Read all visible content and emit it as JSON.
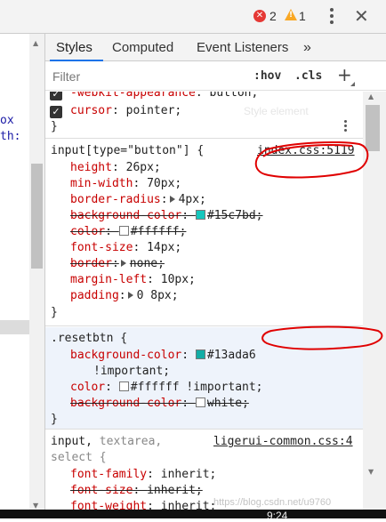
{
  "topbar": {
    "error_count": "2",
    "warning_count": "1",
    "error_icon_glyph": "✕",
    "warning_icon_glyph": "!",
    "close_glyph": "✕"
  },
  "left_pane": {
    "fragment_1": "ox",
    "fragment_2": "th:"
  },
  "tabs": [
    {
      "label": "Styles",
      "active": true
    },
    {
      "label": "Computed"
    },
    {
      "label": "Event Listeners"
    }
  ],
  "tabs_more": "»",
  "filter": {
    "placeholder": "Filter",
    "hov": ":hov",
    "cls": ".cls",
    "add": "+"
  },
  "rules": {
    "r0": {
      "line1_prop": "-webkit-appearance",
      "line1_val": "button;",
      "line2_prop": "cursor",
      "line2_val": "pointer;",
      "close": "}"
    },
    "r1": {
      "selector": "input[type=\"button\"] {",
      "source": "index.css:5119",
      "decls": [
        {
          "prop": "height",
          "val": "26px;"
        },
        {
          "prop": "min-width",
          "val": "70px;"
        },
        {
          "prop": "border-radius",
          "val": "4px;"
        },
        {
          "prop": "background-color",
          "val": "#15c7bd;",
          "swatch": "#15c7bd"
        },
        {
          "prop": "color",
          "val": "#ffffff;",
          "swatch": "#ffffff"
        },
        {
          "prop": "font-size",
          "val": "14px;"
        },
        {
          "prop": "border",
          "val": "none;"
        },
        {
          "prop": "margin-left",
          "val": "10px;"
        },
        {
          "prop": "padding",
          "val": "0 8px;"
        }
      ],
      "close": "}"
    },
    "r2": {
      "selector": ".resetbtn {",
      "decls": [
        {
          "prop": "background-color",
          "val": "#13ada6",
          "swatch": "#13ada6",
          "cont": "!important;"
        },
        {
          "prop": "color",
          "val": "#ffffff !important;",
          "swatch": "#ffffff"
        },
        {
          "prop": "background-color",
          "val": "white;",
          "swatch": "#ffffff"
        }
      ],
      "close": "}"
    },
    "r3": {
      "selector_1": "input,",
      "selector_2": "textarea,",
      "selector_3": "select {",
      "source": "ligerui-common.css:4",
      "decls": [
        {
          "prop": "font-family",
          "val": "inherit;"
        },
        {
          "prop": "font-size",
          "val": "inherit;"
        },
        {
          "prop": "font-weight",
          "val": "inherit;"
        }
      ]
    }
  },
  "bottom": {
    "clock": "9:24",
    "watermark": "https://blog.csdn.net/u9760",
    "faint_tip": "Style element"
  },
  "colors": {
    "accent": "#1a73e8",
    "prop": "#c80000",
    "annotation": "#e00000"
  },
  "icons": [
    "error-icon",
    "warning-icon",
    "kebab-icon",
    "close-icon",
    "checkbox-icon",
    "expand-triangle-icon",
    "color-swatch-icon",
    "plus-icon"
  ]
}
